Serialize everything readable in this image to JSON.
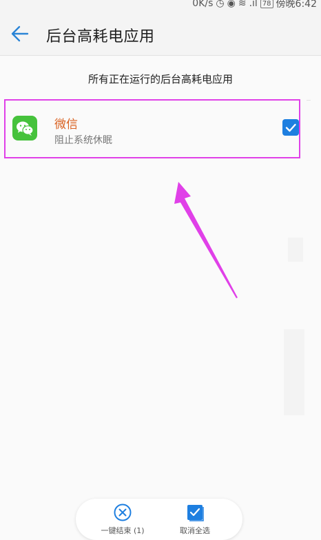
{
  "status_bar": {
    "network_speed": "0K/s",
    "battery": "78",
    "time": "傍晚6:42"
  },
  "header": {
    "back_icon": "arrow-left-icon",
    "title": "后台高耗电应用"
  },
  "subtitle": "所有正在运行的后台高耗电应用",
  "app_list": [
    {
      "icon": "wechat-icon",
      "name": "微信",
      "description": "阻止系统休眠",
      "checked": true
    }
  ],
  "bottom_bar": {
    "end_all_label": "一键结束 (1)",
    "end_all_icon": "circle-x-icon",
    "deselect_label": "取消全选",
    "deselect_icon": "checkbox-checked-icon"
  },
  "colors": {
    "accent": "#1e7fe0",
    "app_name": "#d9601f",
    "highlight": "#e040e8"
  }
}
